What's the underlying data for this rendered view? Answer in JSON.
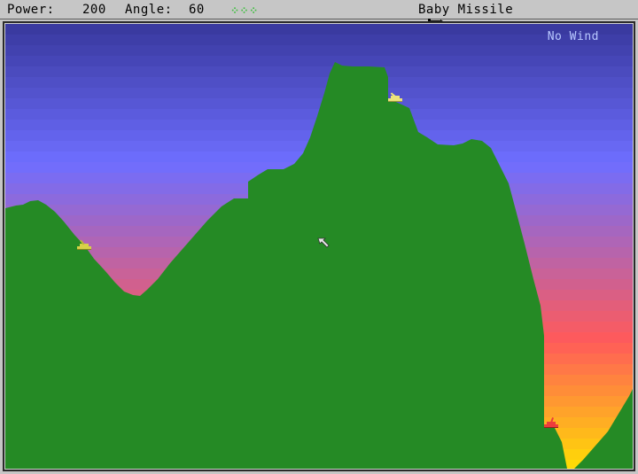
{
  "status_bar": {
    "power_label": "Power:",
    "power_value": "200",
    "angle_label": "Angle:",
    "angle_value": "60",
    "player_name": "⁘⁘⁘",
    "weapon_icon": "weapon-missile-icon",
    "weapon_name": "Baby Missile"
  },
  "playfield": {
    "wind_text": "No Wind"
  },
  "tanks": [
    {
      "name": "player-tank",
      "color": "#d7d247"
    },
    {
      "name": "enemy-tank-top",
      "color": "#ece37a"
    },
    {
      "name": "enemy-tank-right",
      "color": "#ee3c3c"
    }
  ],
  "colors": {
    "terrain": "#258a25",
    "sky_top": "#3a3aa0",
    "sky_mid": "#6e6eff",
    "sky_low": "#ff5a5a",
    "sky_bottom": "#ffe300"
  }
}
